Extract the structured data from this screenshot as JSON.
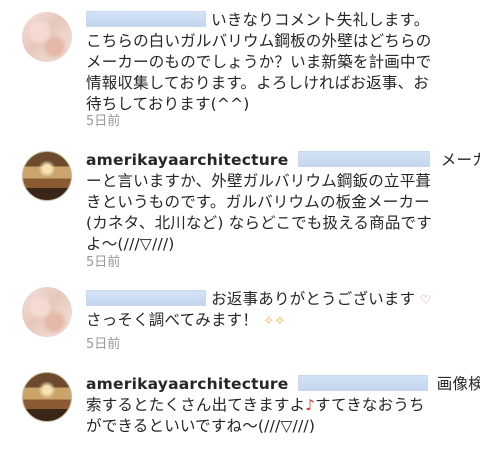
{
  "comments": [
    {
      "lines": [
        "いきなりコメント失礼します。",
        "こちらの白いガルバリウム鋼板の外壁はどちらの",
        "メーカーのものでしょうか？いま新築を計画中で",
        "情報収集しております。よろしければお返事、お",
        "待ちしております(^^)"
      ],
      "time": "5日前"
    },
    {
      "username": "amerikayaarchitecture",
      "lines": [
        "メーカ",
        "ーと言いますか、外壁ガルバリウム鋼鈑の立平葺",
        "きというものです。ガルバリウムの板金メーカー",
        "(カネタ、北川など) ならどこでも扱える商品です",
        "よ〜(///▽///)"
      ],
      "time": "5日前"
    },
    {
      "lines": [
        "お返事ありがとうございます",
        "さっそく調べてみます！"
      ],
      "time": "5日前"
    },
    {
      "username": "amerikayaarchitecture",
      "lines": [
        "画像検",
        "索するとたくさん出てきますよ",
        "すてきなおうち",
        "ができるといいですね〜(///▽///)"
      ],
      "time": "5日前"
    }
  ],
  "icons": {
    "sparkle": "✧✧",
    "heart": "♡",
    "note": "♪"
  }
}
